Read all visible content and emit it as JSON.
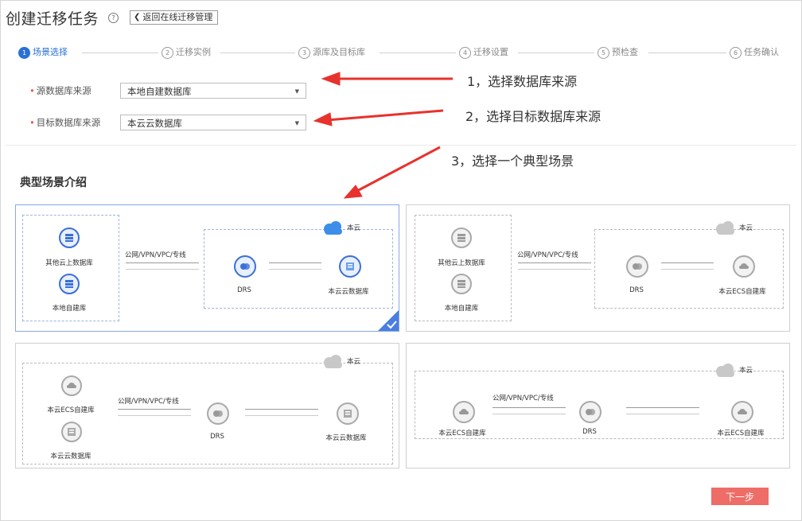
{
  "header": {
    "title": "创建迁移任务",
    "help_icon": "?",
    "back_label": "返回在线迁移管理"
  },
  "steps": [
    {
      "num": "1",
      "label": "场景选择",
      "active": true
    },
    {
      "num": "2",
      "label": "迁移实例",
      "active": false
    },
    {
      "num": "3",
      "label": "源库及目标库",
      "active": false
    },
    {
      "num": "4",
      "label": "迁移设置",
      "active": false
    },
    {
      "num": "5",
      "label": "预检查",
      "active": false
    },
    {
      "num": "6",
      "label": "任务确认",
      "active": false
    }
  ],
  "form": {
    "source": {
      "label": "源数据库来源",
      "value": "本地自建数据库"
    },
    "target": {
      "label": "目标数据库来源",
      "value": "本云云数据库"
    }
  },
  "annotations": {
    "a1": "1，选择数据库来源",
    "a2": "2，选择目标数据库来源",
    "a3": "3，选择一个典型场景"
  },
  "section_title": "典型场景介绍",
  "scenarios": {
    "s1": {
      "src_top": "其他云上数据库",
      "src_bottom": "本地自建库",
      "conn": "公网/VPN/VPC/专线",
      "middle": "DRS",
      "target": "本云云数据库",
      "cloud": "本云"
    },
    "s2": {
      "src_top": "其他云上数据库",
      "src_bottom": "本地自建库",
      "conn": "公网/VPN/VPC/专线",
      "middle": "DRS",
      "target": "本云ECS自建库",
      "cloud": "本云"
    },
    "s3": {
      "src_top": "本云ECS自建库",
      "src_bottom": "本云云数据库",
      "conn": "公网/VPN/VPC/专线",
      "middle": "DRS",
      "target": "本云云数据库",
      "cloud": "本云"
    },
    "s4": {
      "src": "本云ECS自建库",
      "conn": "公网/VPN/VPC/专线",
      "middle": "DRS",
      "target": "本云ECS自建库",
      "cloud": "本云"
    }
  },
  "footer": {
    "next_label": "下一步"
  },
  "colors": {
    "accent": "#2a70d6",
    "primary_button": "#ef6d67",
    "annotation_arrow": "#e8322d",
    "required": "#e8584e"
  }
}
